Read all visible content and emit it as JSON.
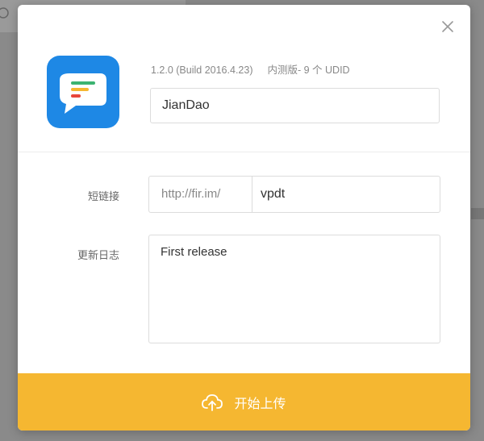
{
  "app": {
    "version_info": "1.2.0 (Build 2016.4.23)",
    "distribution_info": "内测版- 9 个 UDID",
    "name_value": "JianDao",
    "icon": "chat-bubble-icon",
    "icon_color": "#1e88e5"
  },
  "short_link": {
    "label": "短链接",
    "prefix": "http://fir.im/",
    "suffix_value": "vpdt"
  },
  "changelog": {
    "label": "更新日志",
    "value": "First release"
  },
  "upload": {
    "label": "开始上传",
    "icon": "cloud-upload-icon",
    "color": "#f5b731"
  },
  "close": {
    "icon": "close-icon"
  }
}
